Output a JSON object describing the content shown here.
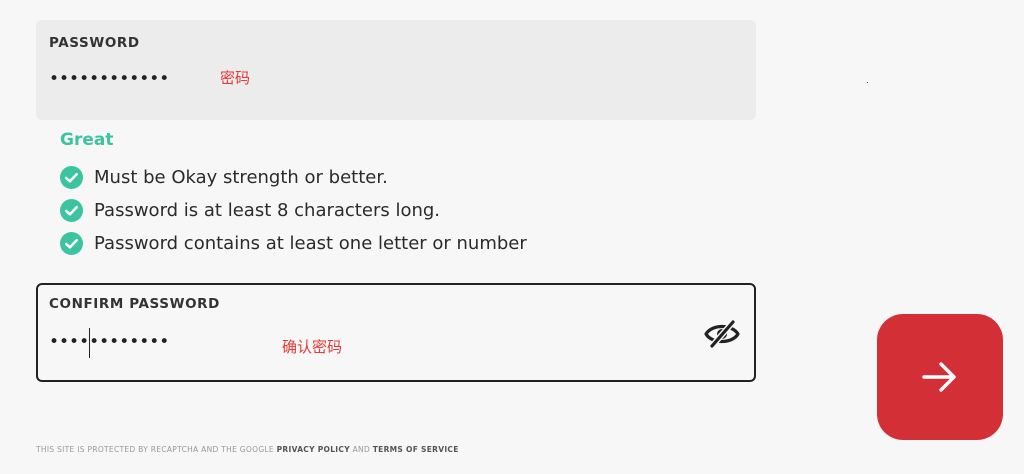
{
  "password": {
    "label": "PASSWORD",
    "value": "••••••••••••",
    "annotation": "密码"
  },
  "strength": {
    "label": "Great",
    "color": "#3cc3a0"
  },
  "requirements": [
    {
      "text": "Must be Okay strength or better.",
      "met": true
    },
    {
      "text": "Password is at least 8 characters long.",
      "met": true
    },
    {
      "text": "Password contains at least one letter or number",
      "met": true
    }
  ],
  "confirm_password": {
    "label": "CONFIRM PASSWORD",
    "value": "••••••••••••",
    "annotation": "确认密码",
    "visibility_icon": "eye-slash-icon"
  },
  "footer": {
    "prefix": "THIS SITE IS PROTECTED BY RECAPTCHA AND THE GOOGLE ",
    "privacy_link": "PRIVACY POLICY",
    "and": " AND ",
    "terms_link": "TERMS OF SERVICE"
  },
  "submit": {
    "icon": "arrow-right-icon",
    "color": "#d32f36"
  }
}
